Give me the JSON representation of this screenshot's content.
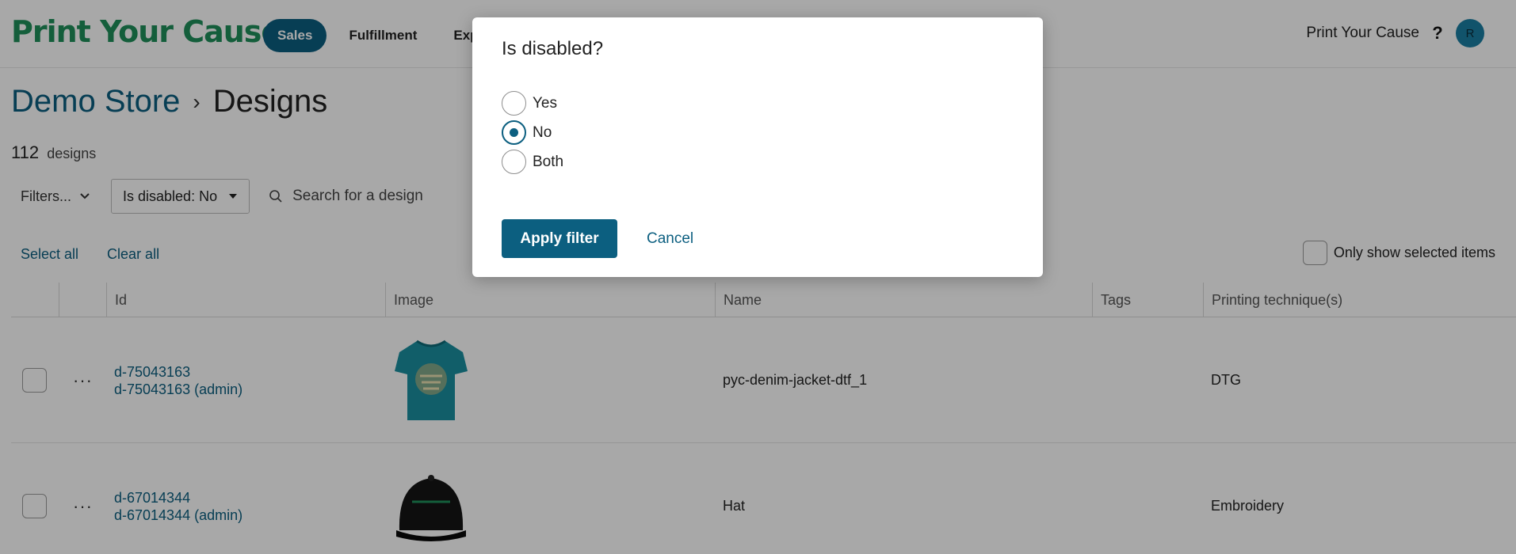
{
  "header": {
    "brand": "Print Your Cause",
    "nav": [
      {
        "label": "Sales",
        "active": true
      },
      {
        "label": "Fulfillment",
        "active": false
      },
      {
        "label": "Exp",
        "active": false
      }
    ],
    "store_name": "Print Your Cause",
    "help_icon": "?",
    "avatar_initial": "R"
  },
  "breadcrumb": {
    "parent": "Demo Store",
    "separator": "›",
    "current": "Designs"
  },
  "summary": {
    "count": "112",
    "count_label": "designs"
  },
  "filters": {
    "filters_label": "Filters...",
    "active_chip": "Is disabled: No",
    "search_placeholder": "Search for a design"
  },
  "selection": {
    "select_all": "Select all",
    "clear_all": "Clear all",
    "only_selected": "Only show selected items"
  },
  "table": {
    "columns": [
      "Id",
      "Image",
      "Name",
      "Tags",
      "Printing technique(s)"
    ],
    "rows": [
      {
        "id": "d-75043163",
        "id_admin": "d-75043163 (admin)",
        "image": "tshirt-thumbnail",
        "name": "pyc-denim-jacket-dtf_1",
        "tags": "",
        "technique": "DTG"
      },
      {
        "id": "d-67014344",
        "id_admin": "d-67014344 (admin)",
        "image": "hat-thumbnail",
        "name": "Hat",
        "tags": "",
        "technique": "Embroidery"
      }
    ],
    "row_menu": "···"
  },
  "modal": {
    "title": "Is disabled?",
    "options": [
      {
        "label": "Yes",
        "checked": false
      },
      {
        "label": "No",
        "checked": true
      },
      {
        "label": "Both",
        "checked": false
      }
    ],
    "apply_label": "Apply filter",
    "cancel_label": "Cancel"
  },
  "colors": {
    "brand_green": "#1f8f5a",
    "primary": "#0c5f80",
    "tshirt": "#1a8fa0",
    "hat": "#141414"
  }
}
